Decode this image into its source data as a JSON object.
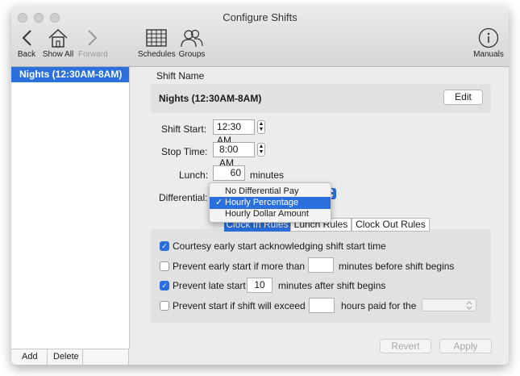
{
  "window": {
    "title": "Configure Shifts"
  },
  "toolbar": {
    "back": "Back",
    "show_all": "Show All",
    "forward": "Forward",
    "schedules": "Schedules",
    "groups": "Groups",
    "manuals": "Manuals"
  },
  "sidebar": {
    "items": [
      {
        "label": "Nights (12:30AM-8AM)"
      }
    ],
    "add_label": "Add",
    "delete_label": "Delete"
  },
  "shift": {
    "name_label": "Shift Name",
    "name_value": "Nights (12:30AM-8AM)",
    "edit_label": "Edit",
    "start_label": "Shift Start:",
    "start_value": "12:30 AM",
    "stop_label": "Stop Time:",
    "stop_value": "8:00 AM",
    "lunch_label": "Lunch:",
    "lunch_value": "60",
    "lunch_unit": "minutes",
    "differential_label": "Differential:",
    "differential_options": [
      "No Differential Pay",
      "Hourly Percentage",
      "Hourly Dollar Amount"
    ],
    "differential_selected": "Hourly Percentage"
  },
  "tabs": [
    {
      "label": "Clock In Rules"
    },
    {
      "label": "Lunch Rules"
    },
    {
      "label": "Clock Out Rules"
    }
  ],
  "rules": {
    "courtesy": {
      "label": "Courtesy early start acknowledging shift start time",
      "checked": true
    },
    "prevent_early": {
      "label": "Prevent early start if more than",
      "value": "",
      "suffix": "minutes before shift begins",
      "checked": false
    },
    "prevent_late": {
      "label": "Prevent late start",
      "value": "10",
      "suffix": "minutes after shift begins",
      "checked": true
    },
    "prevent_exceed": {
      "label": "Prevent start if shift will exceed",
      "value": "",
      "suffix": "hours paid for the",
      "checked": false
    }
  },
  "footer": {
    "revert": "Revert",
    "apply": "Apply"
  },
  "colors": {
    "accent": "#2a6fdc"
  }
}
